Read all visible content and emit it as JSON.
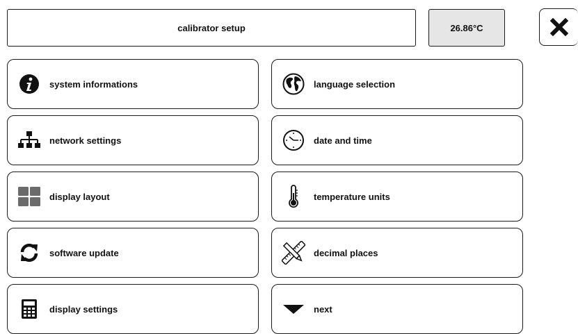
{
  "header": {
    "title": "calibrator setup",
    "temperature": "26.86°C",
    "close_icon": "close-icon"
  },
  "menu": {
    "left": [
      {
        "label": "system informations",
        "icon": "info-icon"
      },
      {
        "label": "network settings",
        "icon": "network-icon"
      },
      {
        "label": "display layout",
        "icon": "grid-layout-icon"
      },
      {
        "label": "software update",
        "icon": "refresh-icon"
      },
      {
        "label": "display settings",
        "icon": "calculator-icon"
      }
    ],
    "right": [
      {
        "label": "language selection",
        "icon": "globe-icon"
      },
      {
        "label": "date and time",
        "icon": "clock-icon"
      },
      {
        "label": "temperature units",
        "icon": "thermometer-icon"
      },
      {
        "label": "decimal places",
        "icon": "pencil-ruler-icon"
      },
      {
        "label": "next",
        "icon": "triangle-down-icon"
      }
    ]
  },
  "colors": {
    "border": "#1a1a1a",
    "temperature_bg": "#e6e6e6",
    "layout_tile": "#6b6b6b"
  }
}
